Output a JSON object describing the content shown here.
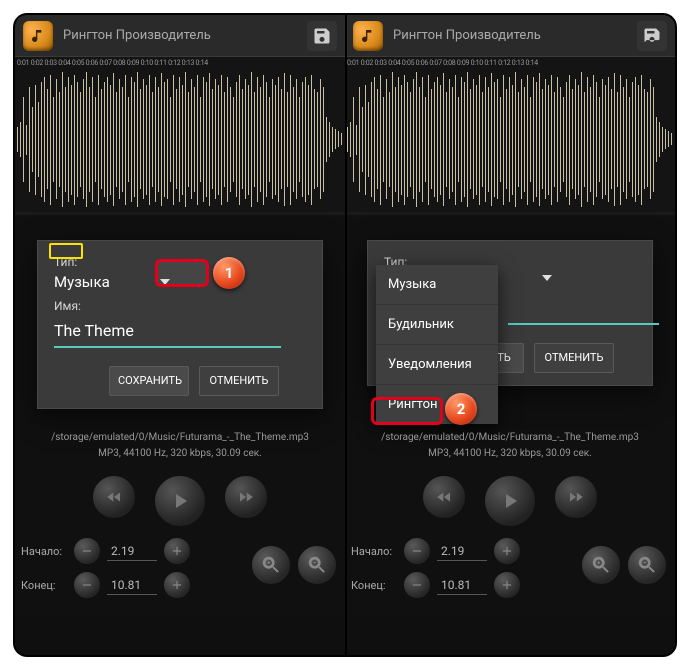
{
  "app": {
    "title": "Рингтон Производитель",
    "timeline_ticks": "0:01 0:02 0:03 0:04 0:05 0:06 0:07 0:08 0:09 0:10 0:11 0:12 0:13 0:14"
  },
  "file": {
    "path": "/storage/emulated/0/Music/Futurama_-_The_Theme.mp3",
    "meta": "MP3, 44100 Hz, 320 kbps, 30.09 сек."
  },
  "dialog": {
    "type_label": "Тип:",
    "type_value": "Музыка",
    "name_label": "Имя:",
    "name_value": "The Theme",
    "save": "СОХРАНИТЬ",
    "cancel": "ОТМЕНИТЬ"
  },
  "dropdown": {
    "options": [
      "Музыка",
      "Будильник",
      "Уведомления",
      "Рингтон"
    ]
  },
  "trim": {
    "start_label": "Начало:",
    "end_label": "Конец:",
    "start_value": "2.19",
    "end_value": "10.81"
  },
  "callouts": {
    "one": "1",
    "two": "2"
  },
  "icons": {
    "note": "note-icon",
    "save": "save-icon",
    "dropdown": "chevron-down-icon",
    "rewind": "rewind-icon",
    "play": "play-icon",
    "forward": "forward-icon",
    "minus": "minus-icon",
    "plus": "plus-icon",
    "zoom_in": "zoom-in-icon",
    "zoom_out": "zoom-out-icon"
  }
}
